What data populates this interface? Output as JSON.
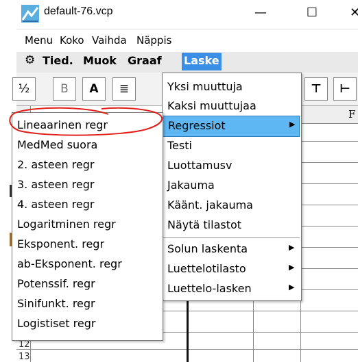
{
  "window": {
    "title": "default-76.vcp",
    "minimize": "—",
    "maximize": "☐",
    "close": "✕"
  },
  "menubar": {
    "items": [
      "Menu",
      "Koko",
      "Vaihda",
      "Näppis"
    ]
  },
  "tabs": {
    "gear": "⚙",
    "items": [
      "Tied.",
      "Muok",
      "Graaf"
    ],
    "active": "Laske"
  },
  "toolbar": {
    "frac": "½",
    "bold": "B",
    "font": "A",
    "align": "≣",
    "b1": "⊤",
    "b2": "⊢"
  },
  "sheet": {
    "header_f": "F",
    "row12": "12",
    "row13": "13"
  },
  "laske_menu": {
    "items": [
      {
        "label": "Yksi muuttuja",
        "submenu": false
      },
      {
        "label": "Kaksi muuttujaa",
        "submenu": false
      },
      {
        "label": "Regressiot",
        "submenu": true,
        "active": true
      },
      {
        "label": "Testi",
        "submenu": false
      },
      {
        "label": "Luottamusv",
        "submenu": false
      },
      {
        "label": "Jakauma",
        "submenu": false
      },
      {
        "label": "Käänt. jakauma",
        "submenu": false
      },
      {
        "label": "Näytä tilastot",
        "submenu": false
      },
      {
        "label": "Solun laskenta",
        "submenu": true
      },
      {
        "label": "Luettelotilasto",
        "submenu": true
      },
      {
        "label": "Luettelo-lasken",
        "submenu": true
      }
    ],
    "arrow": "▶"
  },
  "regressiot_menu": {
    "items": [
      "Lineaarinen regr",
      "MedMed suora",
      "2. asteen regr",
      "3. asteen regr",
      "4. asteen regr",
      "Logaritminen regr",
      "Eksponent. regr",
      "ab-Eksponent. regr",
      "Potenssif. regr",
      "Sinifunkt. regr",
      "Logistiset regr"
    ]
  },
  "colors": {
    "active_tab": "#3a8ee6",
    "highlight": "#5eb6f2",
    "annotation": "#e0201a"
  }
}
